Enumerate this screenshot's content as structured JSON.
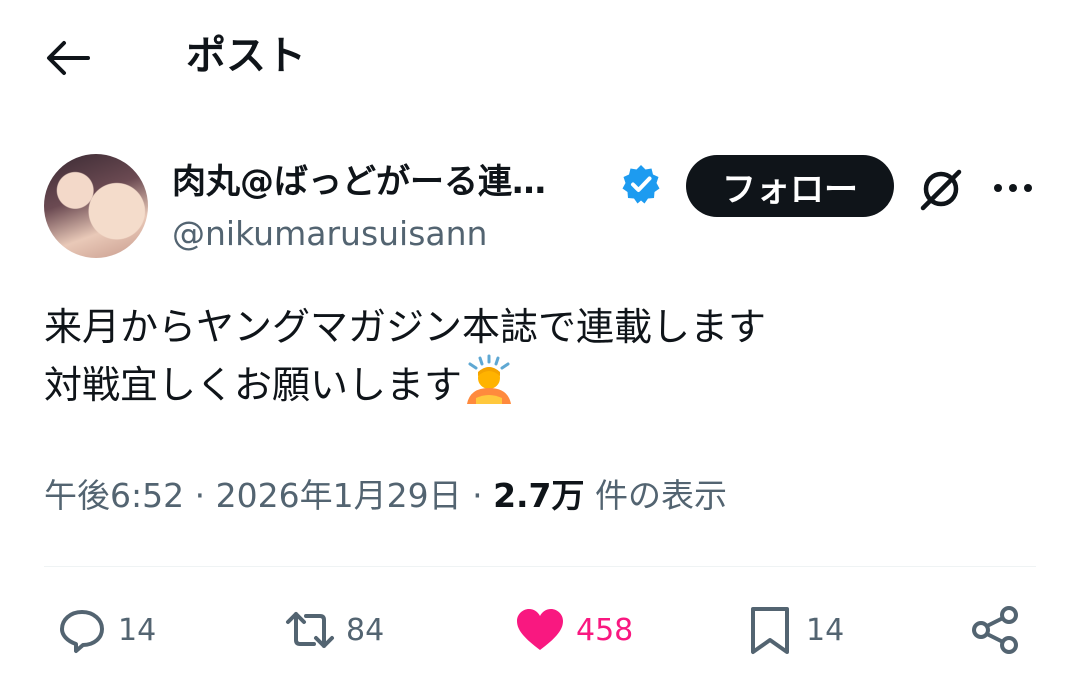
{
  "header": {
    "title": "ポスト",
    "back_icon": "arrow-left-icon"
  },
  "author": {
    "display_name": "肉丸@ばっどがーる連…",
    "handle": "@nikumarusuisann",
    "verified_color": "#1d9bf0",
    "follow_label": "フォロー"
  },
  "tweet": {
    "text": "来月からヤングマガジン本誌で連載します\n対戦宜しくお願いします",
    "emoji": "person-bowing-emoji"
  },
  "meta": {
    "time": "午後6:52",
    "sep1": " · ",
    "date": "2026年1月29日",
    "sep2": " · ",
    "views_count": "2.7万",
    "views_label": " 件の表示"
  },
  "actions": {
    "replies": "14",
    "reposts": "84",
    "likes": "458",
    "bookmarks": "14"
  },
  "colors": {
    "like": "#f91880",
    "secondary_text": "#536471"
  }
}
